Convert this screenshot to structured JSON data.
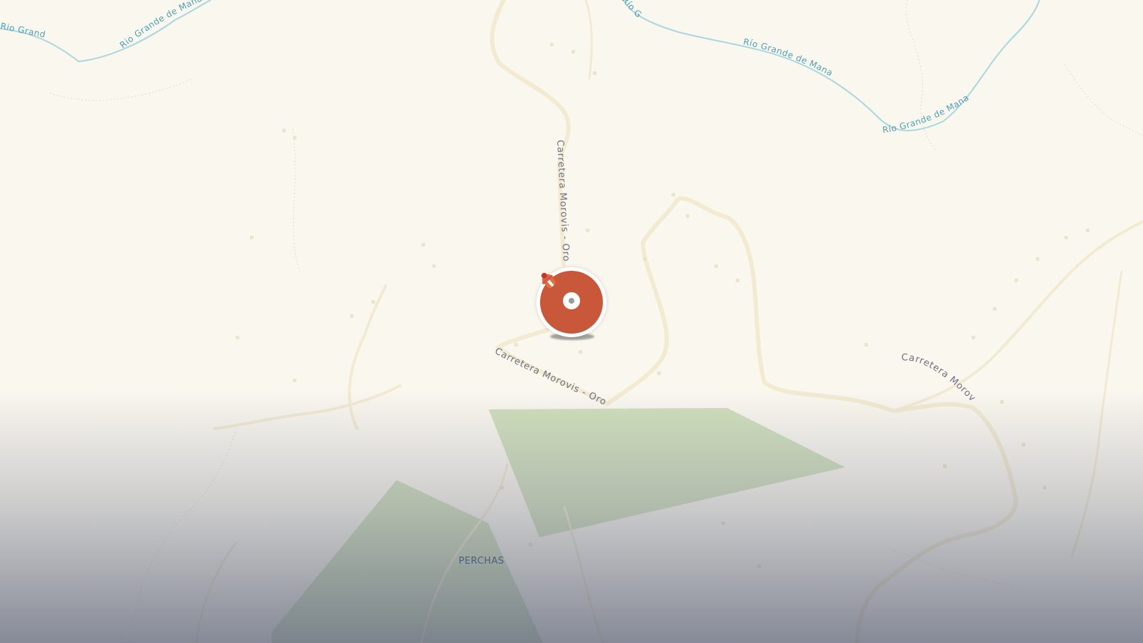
{
  "map": {
    "rivers": [
      {
        "id": "river-top-left-a",
        "label": "Rio Grande de Manatí"
      },
      {
        "id": "river-top-left-b",
        "label": "Rio Grande de Manatí"
      },
      {
        "id": "river-top-center",
        "label": "Río Grande de Manatí"
      },
      {
        "id": "river-top-right-a",
        "label": "Río Grande de Manatí"
      },
      {
        "id": "river-top-right-b",
        "label": "Río Grande de Manatí"
      }
    ],
    "roads": [
      {
        "id": "road-north",
        "label": "Carretera Morovis - Orocovis"
      },
      {
        "id": "road-south",
        "label": "Carretera Morovis - Orocovis"
      },
      {
        "id": "road-east",
        "label": "Carretera Morovis - Orocovis"
      }
    ],
    "places": [
      {
        "id": "perchas",
        "label": "PERCHAS"
      }
    ],
    "colors": {
      "background": "#faf7ef",
      "river": "#a9d6e0",
      "road": "#f3ead2",
      "park": "#c8dbb4",
      "marker": "#c9583a"
    },
    "marker": {
      "icon": "fire-hydrant-icon"
    }
  }
}
